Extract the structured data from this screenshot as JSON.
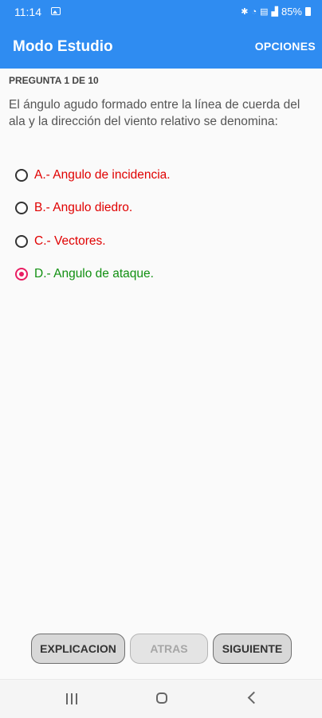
{
  "status": {
    "time": "11:14",
    "battery": "85%",
    "icons": [
      "gallery-icon",
      "bluetooth-icon",
      "wifi-icon",
      "volte-icon",
      "signal-icon",
      "battery-icon"
    ]
  },
  "app_bar": {
    "title": "Modo Estudio",
    "options_label": "OPCIONES",
    "color": "#2f8cf1"
  },
  "quiz": {
    "counter": "PREGUNTA 1 DE 10",
    "question": "El ángulo agudo formado entre la línea de cuerda del ala y la dirección del viento relativo se denomina:",
    "answers": [
      {
        "label": "A.- Angulo de incidencia.",
        "state": "wrong",
        "selected": false
      },
      {
        "label": "B.- Angulo diedro.",
        "state": "wrong",
        "selected": false
      },
      {
        "label": "C.- Vectores.",
        "state": "wrong",
        "selected": false
      },
      {
        "label": "D.- Angulo de ataque.",
        "state": "correct",
        "selected": true
      }
    ],
    "colors": {
      "wrong": "#e00000",
      "correct": "#119011",
      "selected_radio": "#e91e63"
    }
  },
  "buttons": {
    "explanation": "EXPLICACION",
    "back": "ATRAS",
    "back_enabled": false,
    "next": "SIGUIENTE"
  },
  "nav": {
    "icons": [
      "recent-apps-icon",
      "home-icon",
      "back-icon"
    ]
  }
}
